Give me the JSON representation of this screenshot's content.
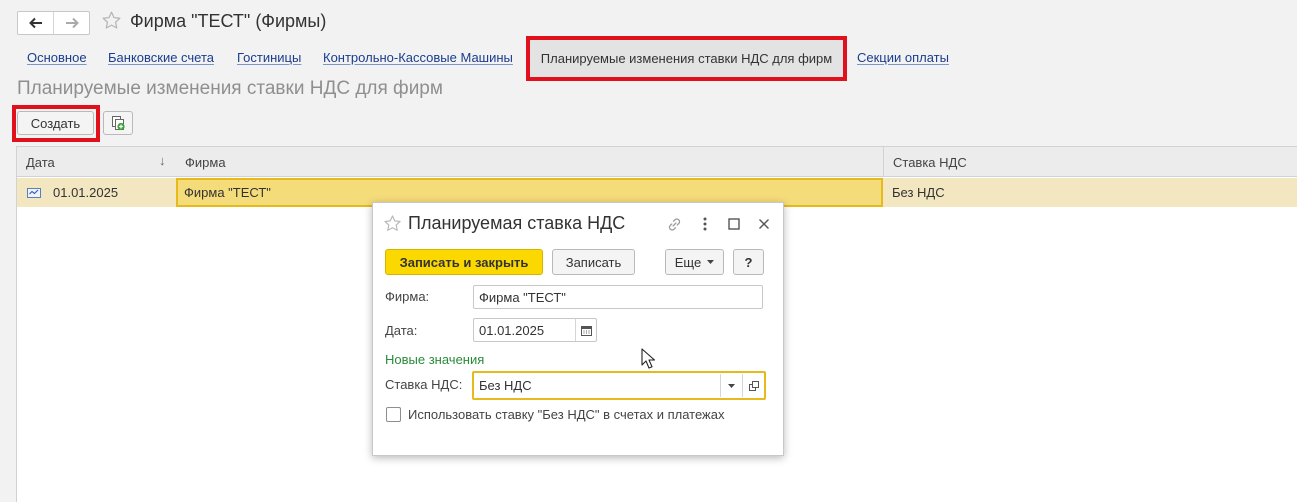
{
  "window": {
    "title": "Фирма \"ТЕСТ\" (Фирмы)"
  },
  "tabs": [
    {
      "label": "Основное"
    },
    {
      "label": "Банковские счета"
    },
    {
      "label": "Гостиницы"
    },
    {
      "label": "Контрольно-Кассовые Машины"
    },
    {
      "label": "Планируемые изменения ставки НДС для фирм",
      "active": true
    },
    {
      "label": "Секции оплаты"
    }
  ],
  "section": {
    "title": "Планируемые изменения ставки НДС для фирм"
  },
  "toolbar": {
    "create_label": "Создать"
  },
  "table": {
    "columns": [
      "Дата",
      "Фирма",
      "Ставка НДС"
    ],
    "rows": [
      {
        "date": "01.01.2025",
        "firm": "Фирма \"ТЕСТ\"",
        "vat": "Без НДС",
        "selected": true
      }
    ]
  },
  "dialog": {
    "title": "Планируемая ставка НДС",
    "save_close_label": "Записать и закрыть",
    "save_label": "Записать",
    "more_label": "Еще",
    "help_label": "?",
    "firm_label": "Фирма:",
    "firm_value": "Фирма \"ТЕСТ\"",
    "date_label": "Дата:",
    "date_value": "01.01.2025",
    "group_label": "Новые значения",
    "vat_label": "Ставка НДС:",
    "vat_value": "Без НДС",
    "checkbox_label": "Использовать ставку \"Без НДС\" в счетах и платежах",
    "checkbox_checked": false
  },
  "colors": {
    "highlight_frame": "#e0101c",
    "primary_button": "#fbd800",
    "selected_row": "#f2e7c0",
    "focus_border": "#e8b91a",
    "group_label": "#2a8a3a",
    "tab_link": "#1a3d8f"
  },
  "icons": {
    "back": "arrow-left-icon",
    "forward": "arrow-right-icon",
    "favorite": "star-icon",
    "copy": "copy-icon",
    "row_type": "record-icon",
    "link": "link-icon",
    "menu": "more-vertical-icon",
    "maximize": "maximize-icon",
    "close": "close-icon",
    "calendar": "calendar-icon",
    "dropdown": "chevron-down-icon",
    "open": "open-icon"
  }
}
